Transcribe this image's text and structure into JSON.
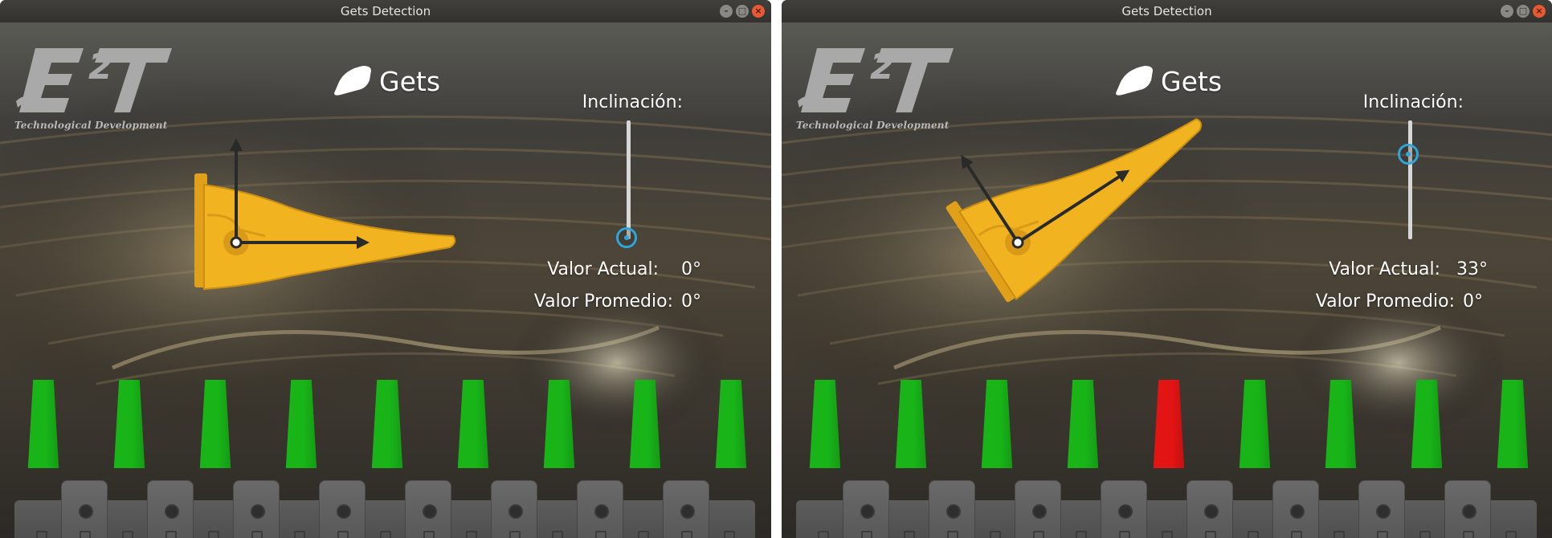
{
  "windows": [
    {
      "title": "Gets Detection",
      "header": {
        "logo_text": "Technological Development",
        "title": "Gets"
      },
      "inclination_label": "Inclinación:",
      "inclination_level": 0,
      "actual_label": "Valor Actual:",
      "actual_value": "0°",
      "average_label": "Valor Promedio:",
      "average_value": "0°",
      "tooth_angle_deg": 0,
      "tooth_status": [
        "ok",
        "ok",
        "ok",
        "ok",
        "ok",
        "ok",
        "ok",
        "ok",
        "ok"
      ]
    },
    {
      "title": "Gets Detection",
      "header": {
        "logo_text": "Technological Development",
        "title": "Gets"
      },
      "inclination_label": "Inclinación:",
      "inclination_level": 0.7,
      "actual_label": "Valor Actual:",
      "actual_value": "33°",
      "average_label": "Valor Promedio:",
      "average_value": "0°",
      "tooth_angle_deg": 33,
      "tooth_status": [
        "ok",
        "ok",
        "ok",
        "ok",
        "missing",
        "ok",
        "ok",
        "ok",
        "ok"
      ]
    }
  ],
  "icons": {
    "window_minimize": "minimize-icon",
    "window_maximize": "maximize-icon",
    "window_close": "close-icon",
    "gets": "bucket-tooth-icon",
    "logo": "e2t-logo"
  },
  "colors": {
    "ok": "#18b418",
    "missing": "#e31414",
    "tooth_body": "#f2b321",
    "slider_accent": "#2fa6d9"
  }
}
